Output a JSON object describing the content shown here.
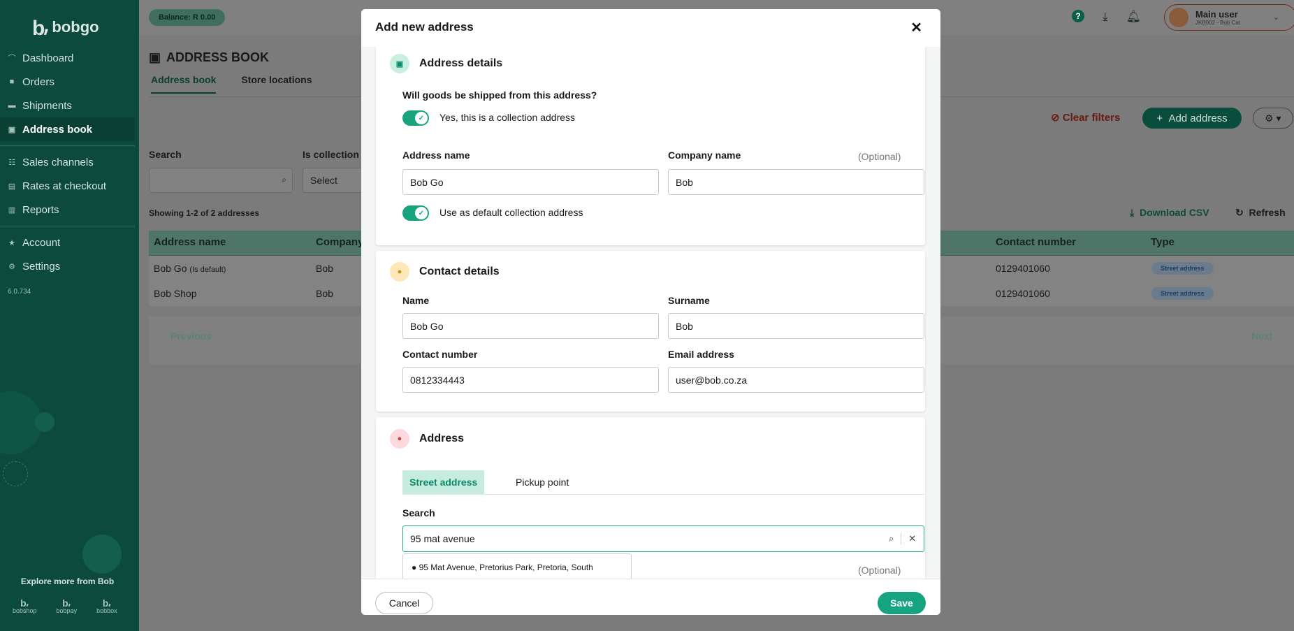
{
  "sidebar": {
    "brand": "bobgo",
    "brand_mark": "b̵",
    "items": [
      {
        "label": "Dashboard",
        "icon": "chart-icon"
      },
      {
        "label": "Orders",
        "icon": "orders-icon"
      },
      {
        "label": "Shipments",
        "icon": "truck-icon"
      },
      {
        "label": "Address book",
        "icon": "book-icon"
      },
      {
        "label": "Sales channels",
        "icon": "channels-icon"
      },
      {
        "label": "Rates at checkout",
        "icon": "cart-icon"
      },
      {
        "label": "Reports",
        "icon": "report-icon"
      },
      {
        "label": "Account",
        "icon": "star-icon"
      },
      {
        "label": "Settings",
        "icon": "gear-icon"
      }
    ],
    "version": "6.0.734",
    "explore": "Explore more from Bob",
    "apps": [
      "bobshop",
      "bobpay",
      "bobbox"
    ]
  },
  "topbar": {
    "balance": "Balance: R 0.00",
    "user_name": "Main user",
    "user_sub": "JKB002 - Bob Cat"
  },
  "page": {
    "title": "ADDRESS BOOK",
    "tabs": [
      "Address book",
      "Store locations"
    ],
    "clear_filters": "Clear filters",
    "add_address": "Add address",
    "filters": {
      "search_label": "Search",
      "collection_label": "Is collection",
      "collection_value": "Select"
    },
    "showing": "Showing 1-2 of 2 addresses",
    "download_csv": "Download CSV",
    "refresh": "Refresh",
    "columns": [
      "Address name",
      "Company",
      "Contact number",
      "Type"
    ],
    "rows": [
      {
        "name": "Bob Go",
        "default_tag": "(Is default)",
        "company": "Bob",
        "contact": "0129401060",
        "type": "Street address"
      },
      {
        "name": "Bob Shop",
        "default_tag": "",
        "company": "Bob",
        "contact": "0129401060",
        "type": "Street address"
      }
    ],
    "previous": "Previous",
    "next": "Next"
  },
  "modal": {
    "title": "Add new address",
    "address_details": {
      "heading": "Address details",
      "question": "Will goods be shipped from this address?",
      "collection_toggle": "Yes, this is a collection address",
      "address_name_label": "Address name",
      "address_name_value": "Bob Go",
      "company_label": "Company name",
      "company_optional": "(Optional)",
      "company_value": "Bob",
      "default_toggle": "Use as default collection address"
    },
    "contact_details": {
      "heading": "Contact details",
      "name_label": "Name",
      "name_value": "Bob Go",
      "surname_label": "Surname",
      "surname_value": "Bob",
      "contact_label": "Contact number",
      "contact_value": "0812334443",
      "email_label": "Email address",
      "email_value": "user@bob.co.za"
    },
    "address": {
      "heading": "Address",
      "tab_street": "Street address",
      "tab_pickup": "Pickup point",
      "search_label": "Search",
      "search_value": "95 mat avenue",
      "suggestion": "95 Mat Avenue, Pretorius Park, Pretoria, South",
      "optional": "(Optional)"
    },
    "cancel": "Cancel",
    "save": "Save"
  },
  "colors": {
    "brand": "#16a37f",
    "sidebar": "#0b4a3c"
  }
}
